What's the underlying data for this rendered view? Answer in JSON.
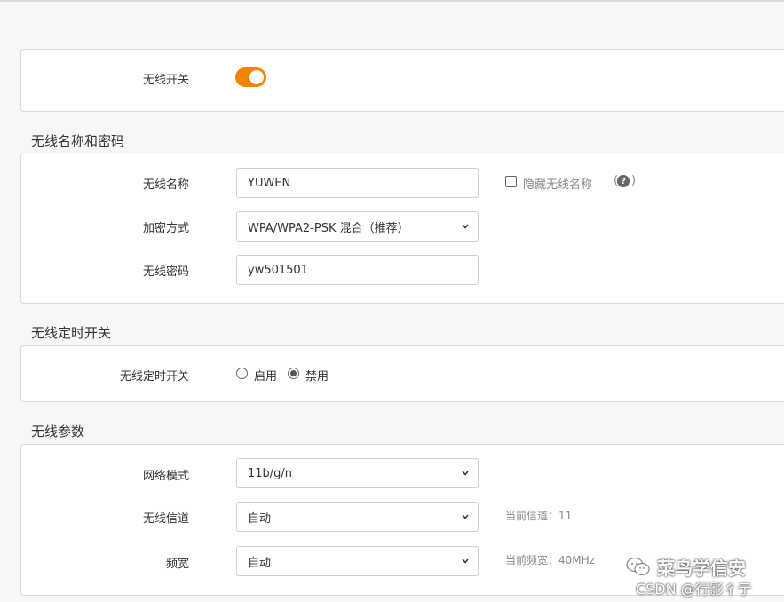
{
  "wireless_switch": {
    "label": "无线开关",
    "enabled": true,
    "color": "#f08300"
  },
  "ssid_section": {
    "title": "无线名称和密码",
    "ssid_label": "无线名称",
    "ssid_value": "YUWEN",
    "hide_ssid_label": "隐藏无线名称",
    "hide_ssid_checked": false,
    "help_icon": "question-circle-icon",
    "encryption_label": "加密方式",
    "encryption_value": "WPA/WPA2-PSK 混合（推荐）",
    "password_label": "无线密码",
    "password_value": "yw501501"
  },
  "schedule_section": {
    "title": "无线定时开关",
    "label": "无线定时开关",
    "option_enable": "启用",
    "option_disable": "禁用",
    "selected": "禁用"
  },
  "params_section": {
    "title": "无线参数",
    "mode_label": "网络模式",
    "mode_value": "11b/g/n",
    "channel_label": "无线信道",
    "channel_value": "自动",
    "channel_current": "当前信道：11",
    "bandwidth_label": "频宽",
    "bandwidth_value": "自动",
    "bandwidth_current": "当前频宽：40MHz"
  },
  "watermark": {
    "line1": "菜鸟学信安",
    "line2": "CSDN @行影彳亍",
    "icon": "wechat-icon"
  }
}
